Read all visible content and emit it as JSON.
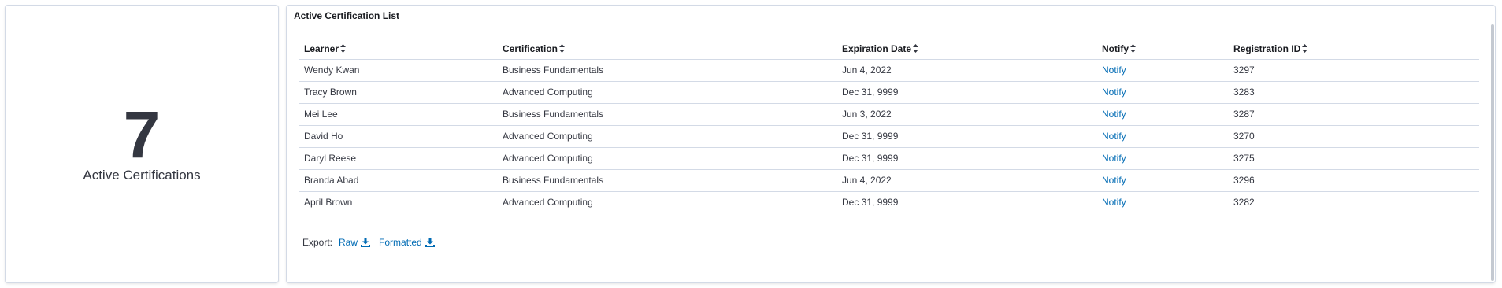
{
  "metric": {
    "value": "7",
    "label": "Active Certifications"
  },
  "table_panel": {
    "title": "Active Certification List",
    "columns": [
      "Learner",
      "Certification",
      "Expiration Date",
      "Notify",
      "Registration ID"
    ],
    "rows": [
      {
        "learner": "Wendy Kwan",
        "certification": "Business Fundamentals",
        "expiration": "Jun 4, 2022",
        "notify": "Notify",
        "registration_id": "3297"
      },
      {
        "learner": "Tracy Brown",
        "certification": "Advanced Computing",
        "expiration": "Dec 31, 9999",
        "notify": "Notify",
        "registration_id": "3283"
      },
      {
        "learner": "Mei Lee",
        "certification": "Business Fundamentals",
        "expiration": "Jun 3, 2022",
        "notify": "Notify",
        "registration_id": "3287"
      },
      {
        "learner": "David Ho",
        "certification": "Advanced Computing",
        "expiration": "Dec 31, 9999",
        "notify": "Notify",
        "registration_id": "3270"
      },
      {
        "learner": "Daryl Reese",
        "certification": "Advanced Computing",
        "expiration": "Dec 31, 9999",
        "notify": "Notify",
        "registration_id": "3275"
      },
      {
        "learner": "Branda Abad",
        "certification": "Business Fundamentals",
        "expiration": "Jun 4, 2022",
        "notify": "Notify",
        "registration_id": "3296"
      },
      {
        "learner": "April Brown",
        "certification": "Advanced Computing",
        "expiration": "Dec 31, 9999",
        "notify": "Notify",
        "registration_id": "3282"
      }
    ],
    "export": {
      "label": "Export:",
      "raw_label": "Raw",
      "formatted_label": "Formatted"
    }
  },
  "colors": {
    "link": "#006bb4",
    "text": "#343741",
    "border": "#d3dae6"
  },
  "icons": {
    "sort": "sort-icon",
    "download": "download-icon"
  }
}
